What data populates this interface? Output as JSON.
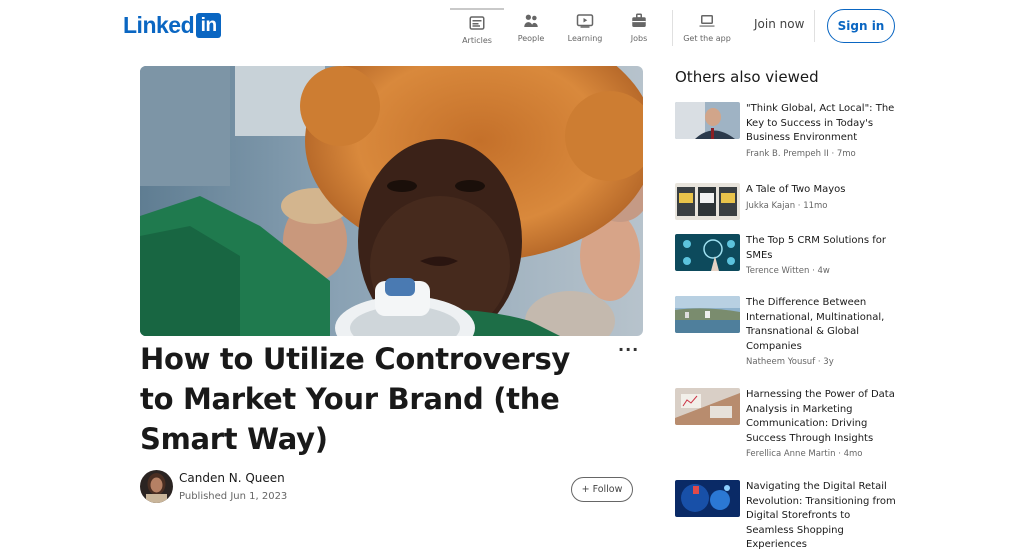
{
  "nav": {
    "logo_text": "Linked",
    "logo_badge": "in",
    "items": [
      {
        "label": "Articles",
        "icon": "articles-icon"
      },
      {
        "label": "People",
        "icon": "people-icon"
      },
      {
        "label": "Learning",
        "icon": "learning-icon"
      },
      {
        "label": "Jobs",
        "icon": "jobs-icon"
      }
    ],
    "get_app": {
      "label": "Get the app",
      "icon": "laptop-icon"
    },
    "join_now": "Join now",
    "sign_in": "Sign in"
  },
  "article": {
    "title": "How to Utilize Controversy to Market Your Brand (the Smart Way)",
    "more": "···",
    "author_name": "Canden N. Queen",
    "published": "Published Jun 1, 2023",
    "follow": "+ Follow"
  },
  "sidebar": {
    "title": "Others also viewed",
    "cards": [
      {
        "title": "\"Think Global, Act Local\": The Key to Success in Today's Business Environment",
        "author": "Frank B. Prempeh II",
        "age": "7mo"
      },
      {
        "title": "A Tale of Two Mayos",
        "author": "Jukka Kajan",
        "age": "11mo"
      },
      {
        "title": "The Top 5 CRM Solutions for SMEs",
        "author": "Terence Witten",
        "age": "4w"
      },
      {
        "title": "The Difference Between International, Multinational, Transnational & Global Companies",
        "author": "Natheem Yousuf",
        "age": "3y"
      },
      {
        "title": "Harnessing the Power of Data Analysis in Marketing Communication: Driving Success Through Insights",
        "author": "Ferellica Anne Martin",
        "age": "4mo"
      },
      {
        "title": "Navigating the Digital Retail Revolution: Transitioning from Digital Storefronts to Seamless Shopping Experiences",
        "author": "",
        "age": ""
      }
    ]
  },
  "colors": {
    "brand": "#0a66c2",
    "text": "#000000",
    "muted": "#666666"
  }
}
